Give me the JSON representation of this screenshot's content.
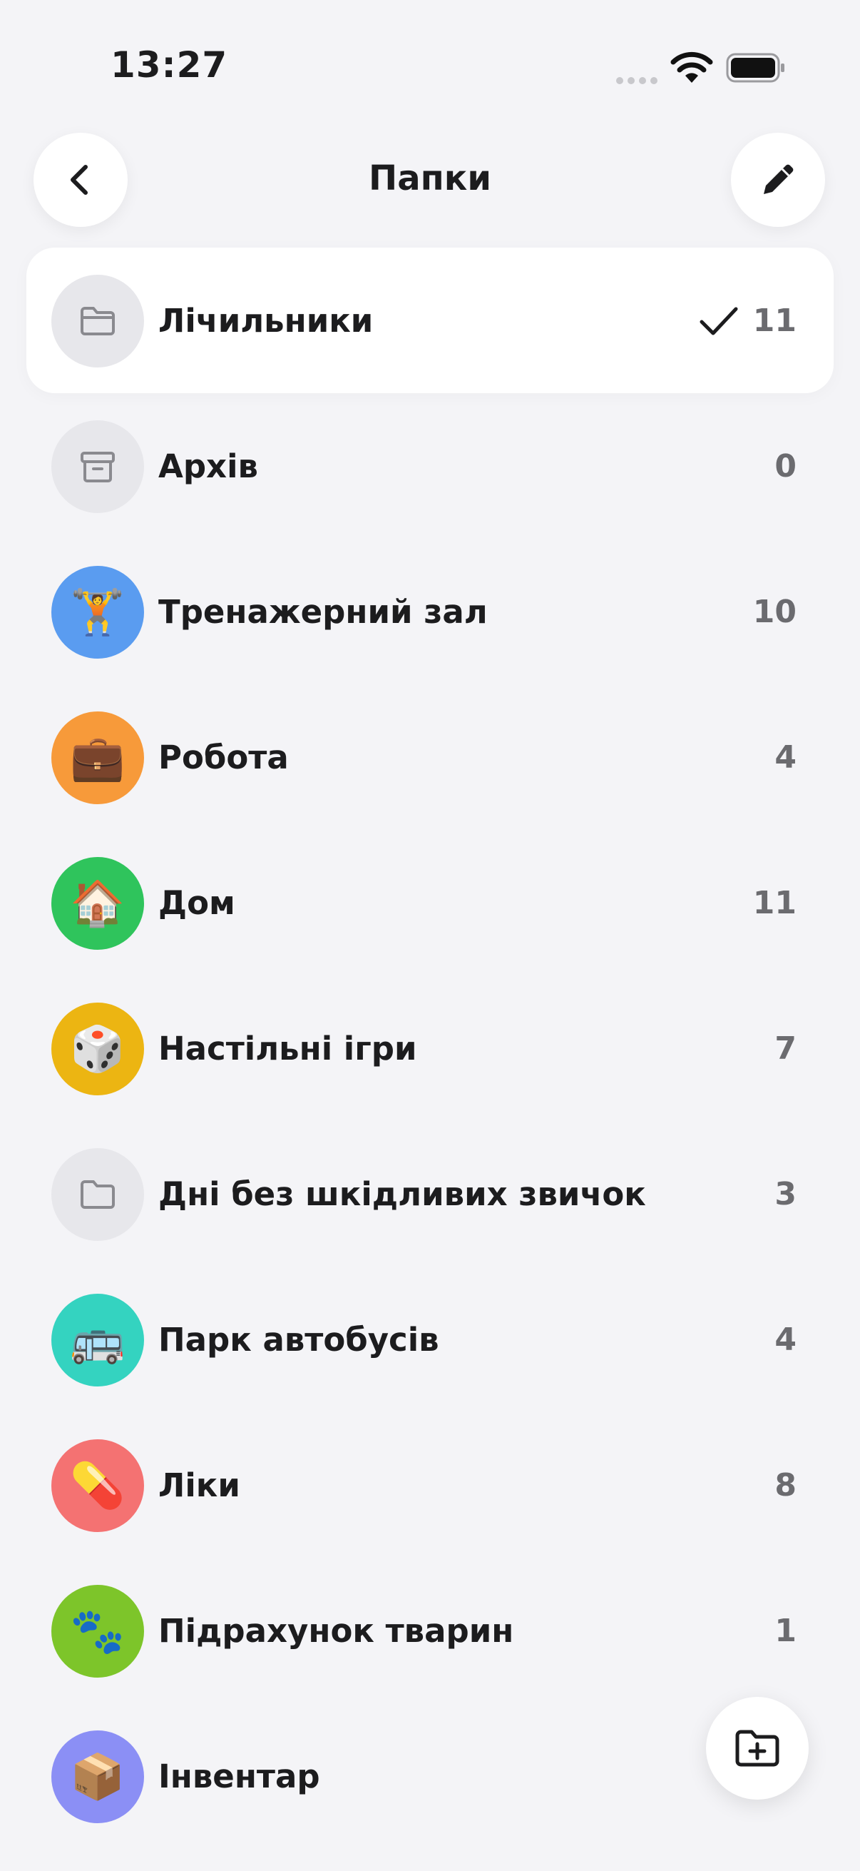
{
  "status_bar": {
    "time": "13:27"
  },
  "header": {
    "title": "Папки"
  },
  "folders": [
    {
      "label": "Лічильники",
      "count": "11",
      "icon": "folder-icon",
      "color": "#e7e7eb",
      "selected": true
    },
    {
      "label": "Архів",
      "count": "0",
      "icon": "archive-icon",
      "color": "#e7e7eb"
    },
    {
      "label": "Тренажерний зал",
      "count": "10",
      "icon": "weightlifter-emoji",
      "emoji": "🏋️",
      "color": "#5a9cf0"
    },
    {
      "label": "Робота",
      "count": "4",
      "icon": "briefcase-emoji",
      "emoji": "💼",
      "color": "#f79a3a"
    },
    {
      "label": "Дом",
      "count": "11",
      "icon": "house-emoji",
      "emoji": "🏠",
      "color": "#2fc45c"
    },
    {
      "label": "Настільні ігри",
      "count": "7",
      "icon": "dice-emoji",
      "emoji": "🎲",
      "color": "#ecb512"
    },
    {
      "label": "Дні без шкідливих звичок",
      "count": "3",
      "icon": "folder-icon",
      "color": "#e7e7eb"
    },
    {
      "label": "Парк автобусів",
      "count": "4",
      "icon": "bus-emoji",
      "emoji": "🚌",
      "color": "#34d3c0"
    },
    {
      "label": "Ліки",
      "count": "8",
      "icon": "pill-emoji",
      "emoji": "💊",
      "color": "#f47272"
    },
    {
      "label": "Підрахунок тварин",
      "count": "1",
      "icon": "paw-prints-emoji",
      "emoji": "🐾",
      "color": "#7dc52a"
    },
    {
      "label": "Інвентар",
      "count": "",
      "icon": "package-emoji",
      "emoji": "📦",
      "color": "#8b8ff5"
    }
  ]
}
